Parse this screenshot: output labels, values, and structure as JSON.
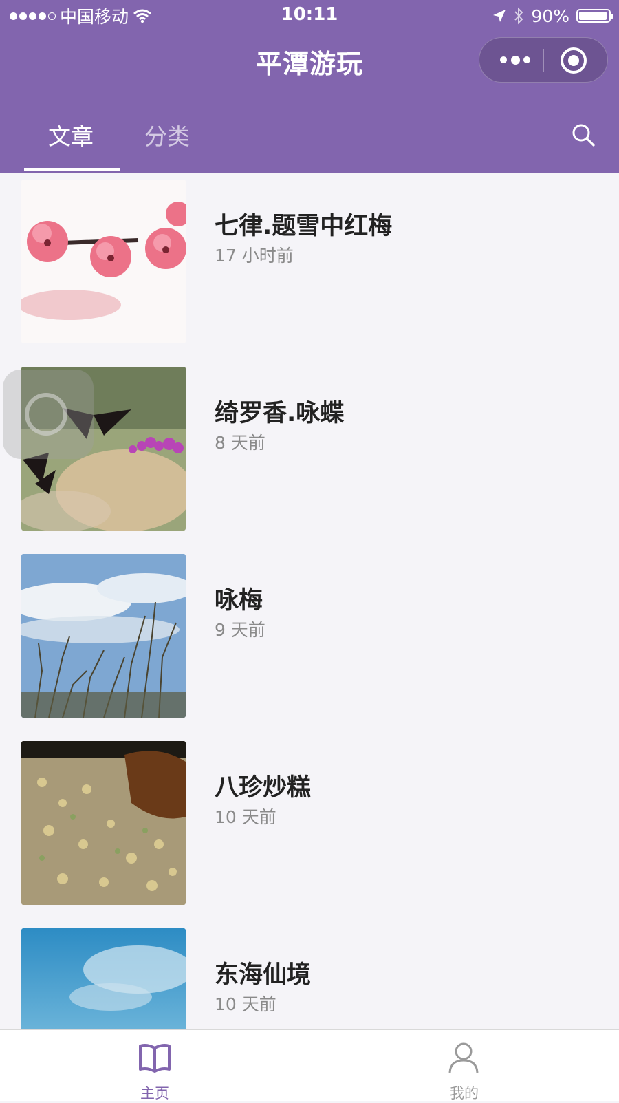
{
  "status_bar": {
    "carrier": "中国移动",
    "time": "10:11",
    "battery": "90%",
    "battery_level": 0.9
  },
  "nav": {
    "title": "平潭游玩"
  },
  "tabs": [
    {
      "label": "文章",
      "active": true
    },
    {
      "label": "分类",
      "active": false
    }
  ],
  "articles": [
    {
      "title": "七律.题雪中红梅",
      "time": "17 小时前",
      "image": "red-plum-blossoms"
    },
    {
      "title": "绮罗香.咏蝶",
      "time": "8 天前",
      "image": "butterflies-on-flowers"
    },
    {
      "title": "咏梅",
      "time": "9 天前",
      "image": "plum-branches-sky"
    },
    {
      "title": "八珍炒糕",
      "time": "10 天前",
      "image": "fried-rice-cake-dish"
    },
    {
      "title": "东海仙境",
      "time": "10 天前",
      "image": "blue-sky-clouds"
    }
  ],
  "tabbar": [
    {
      "label": "主页",
      "icon": "book-icon",
      "active": true
    },
    {
      "label": "我的",
      "icon": "user-icon",
      "active": false
    }
  ],
  "colors": {
    "brand": "#8265ae",
    "background": "#f5f4f8",
    "inactive": "#9a9a9a"
  }
}
